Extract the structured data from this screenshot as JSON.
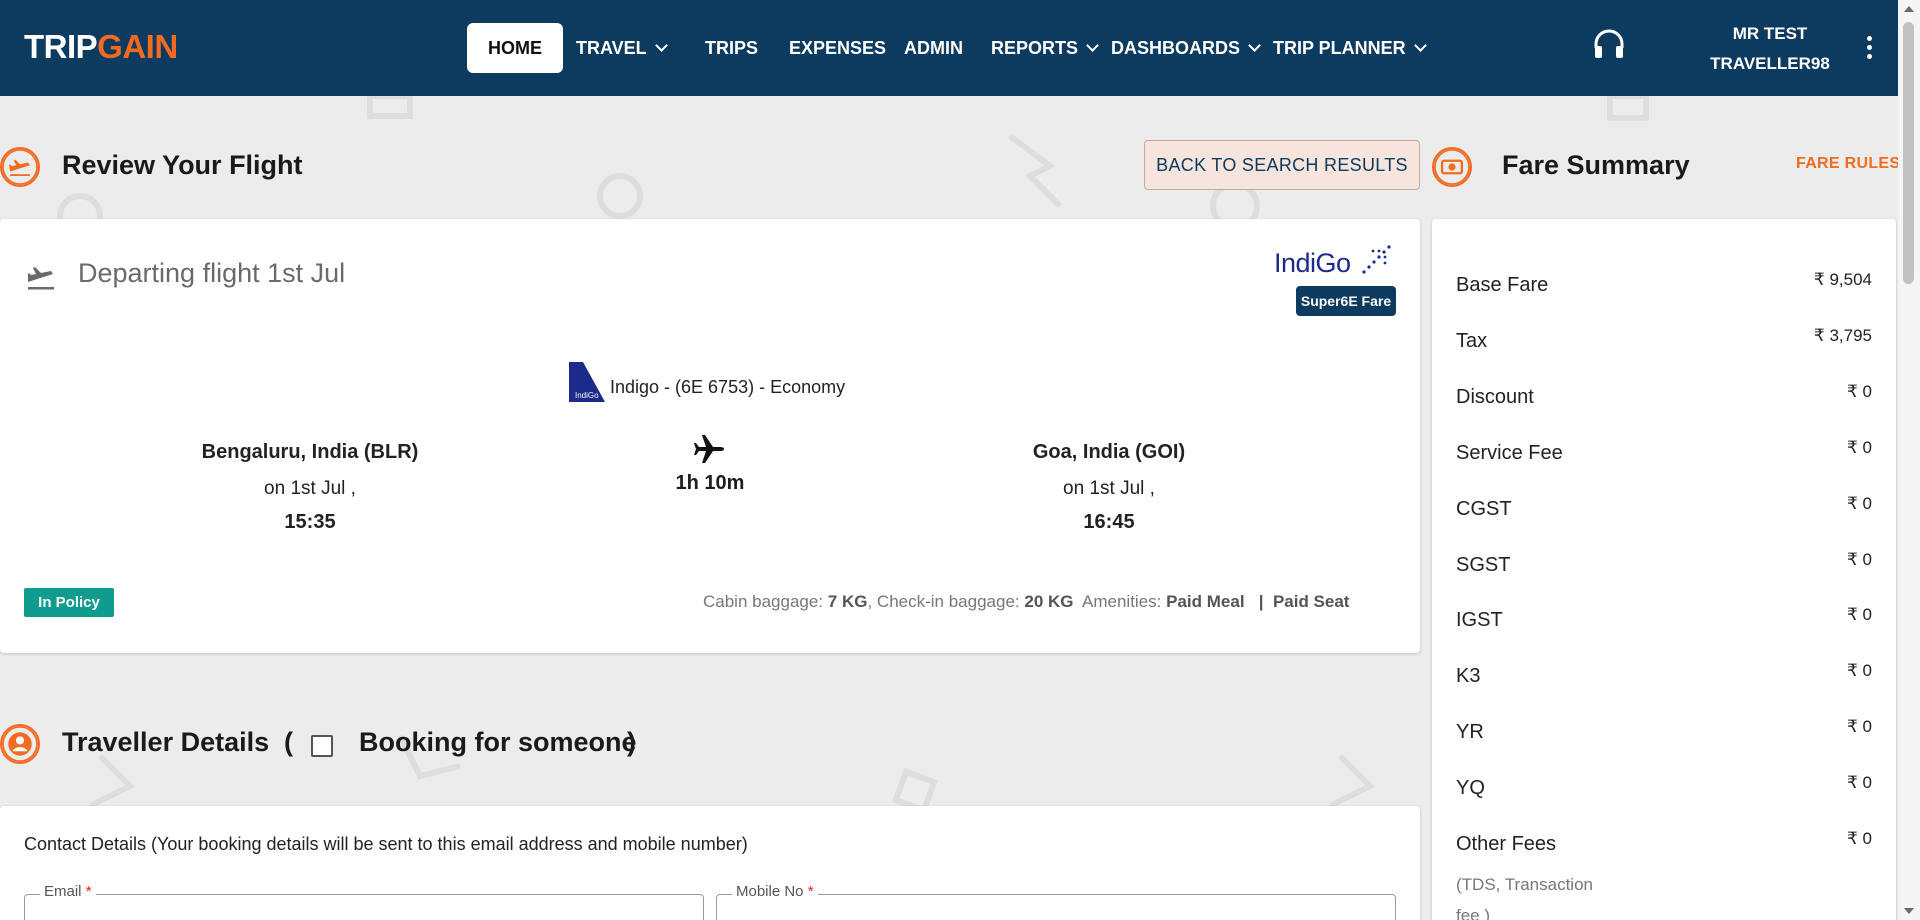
{
  "header": {
    "logo": {
      "part1": "TRIP",
      "part2": "GAIN"
    },
    "nav": [
      {
        "label": "HOME",
        "dropdown": false
      },
      {
        "label": "TRAVEL",
        "dropdown": true
      },
      {
        "label": "TRIPS",
        "dropdown": false
      },
      {
        "label": "EXPENSES",
        "dropdown": false
      },
      {
        "label": "ADMIN",
        "dropdown": false
      },
      {
        "label": "REPORTS",
        "dropdown": true
      },
      {
        "label": "DASHBOARDS",
        "dropdown": true
      },
      {
        "label": "TRIP PLANNER",
        "dropdown": true
      }
    ],
    "user": {
      "line1": "MR TEST",
      "line2": "TRAVELLER98"
    }
  },
  "review": {
    "title": "Review Your Flight",
    "back_button": "BACK TO SEARCH RESULTS"
  },
  "flight": {
    "departing_title": "Departing flight 1st Jul",
    "airline_logo_text": "IndiGo",
    "fare_type": "Super6E Fare",
    "flight_info": "Indigo - (6E 6753) - Economy",
    "origin": {
      "city": "Bengaluru, India (BLR)",
      "date": "on 1st Jul ,",
      "time": "15:35"
    },
    "destination": {
      "city": "Goa, India (GOI)",
      "date": "on 1st Jul ,",
      "time": "16:45"
    },
    "duration": "1h 10m",
    "policy_badge": "In Policy",
    "baggage": {
      "cabin_label": "Cabin baggage:",
      "cabin_value": "7 KG",
      "checkin_label": ", Check-in baggage:",
      "checkin_value": "20 KG",
      "amenities_label": "Amenities:",
      "amenity1": "Paid Meal",
      "separator": "|",
      "amenity2": "Paid Seat"
    }
  },
  "traveller": {
    "title": "Traveller Details",
    "paren_open": "(",
    "booking_for_someone": "Booking for someone",
    "paren_close": ")",
    "contact_text": "Contact Details (Your booking details will be sent to this email address and mobile number)",
    "email_label": "Email",
    "mobile_label": "Mobile No",
    "required_mark": "*"
  },
  "fare_summary": {
    "title": "Fare Summary",
    "rules_link": "FARE RULES",
    "rows": [
      {
        "label": "Base Fare",
        "value": "₹ 9,504"
      },
      {
        "label": "Tax",
        "value": "₹ 3,795"
      },
      {
        "label": "Discount",
        "value": "₹ 0"
      },
      {
        "label": "Service Fee",
        "value": "₹ 0"
      },
      {
        "label": "CGST",
        "value": "₹ 0"
      },
      {
        "label": "SGST",
        "value": "₹ 0"
      },
      {
        "label": "IGST",
        "value": "₹ 0"
      },
      {
        "label": "K3",
        "value": "₹ 0"
      },
      {
        "label": "YR",
        "value": "₹ 0"
      },
      {
        "label": "YQ",
        "value": "₹ 0"
      },
      {
        "label": "Other Fees",
        "value": "₹ 0"
      }
    ],
    "other_fees_note": "(TDS, Transaction fee )"
  },
  "colors": {
    "header_bg": "#0d3a5f",
    "accent": "#f26b21",
    "policy": "#0f9b8e",
    "indigo": "#1c2a8c"
  }
}
